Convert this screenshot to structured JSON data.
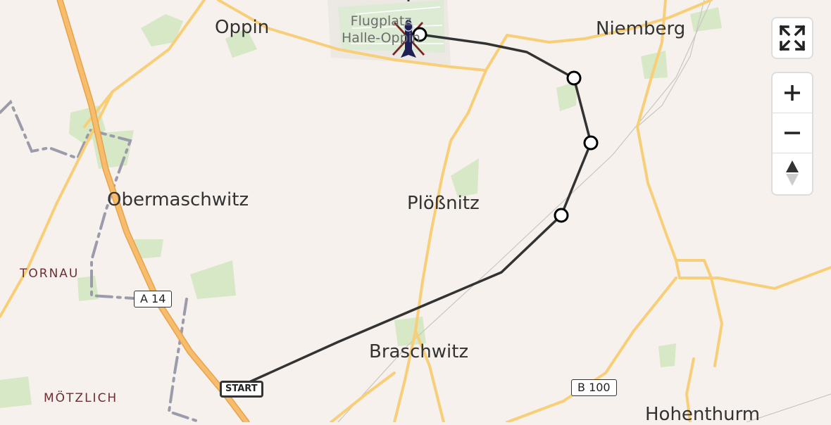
{
  "places": {
    "oppin": "Oppin",
    "niemberg": "Niemberg",
    "airport_line1": "Flugplatz",
    "airport_line2": "Halle-Oppin",
    "obermaschwitz": "Obermaschwitz",
    "ploessnitz": "Plößnitz",
    "braschwitz": "Braschwitz",
    "hohenthurm": "Hohenthurm",
    "tornau": "TORNAU",
    "moetzlich": "MÖTZLICH"
  },
  "road_shields": {
    "a14": "A 14",
    "b100": "B 100"
  },
  "route": {
    "start_label": "START"
  },
  "controls": {
    "fullscreen": "fullscreen-icon",
    "zoom_in": "plus-icon",
    "zoom_out": "minus-icon",
    "reset_north": "compass-icon"
  },
  "colors": {
    "background": "#f6f1ec",
    "road": "#f8cf78",
    "motorway": "#f3b560",
    "route": "#333333",
    "green": "#d6e8c5",
    "boundary": "#9b9bab"
  }
}
